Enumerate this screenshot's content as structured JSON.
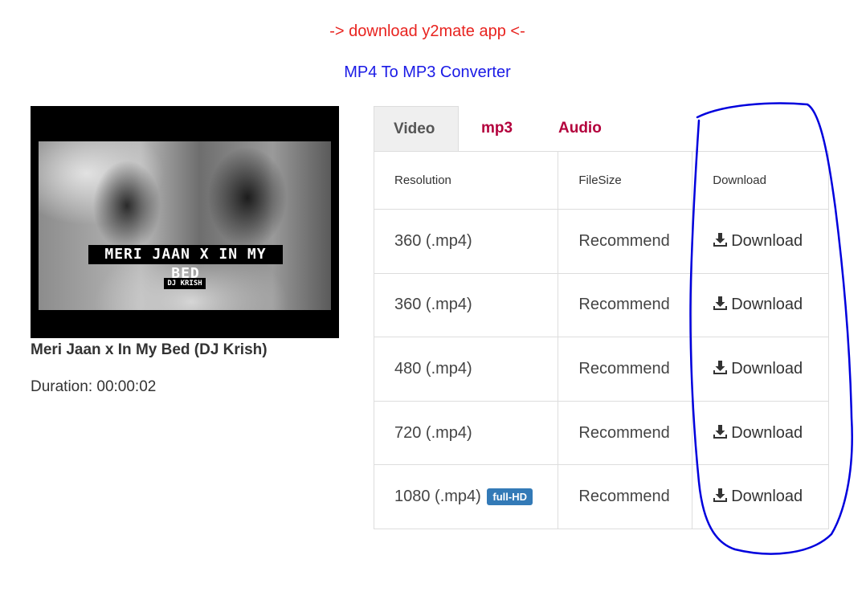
{
  "header": {
    "app_link": "-> download y2mate app <-",
    "converter_link": "MP4 To MP3 Converter"
  },
  "video": {
    "thumbnail_title": "MERI JAAN X IN MY BED",
    "thumbnail_sub": "DJ KRISH",
    "title": "Meri Jaan x In My Bed (DJ Krish)",
    "duration": "Duration: 00:00:02"
  },
  "tabs": [
    {
      "label": "Video",
      "active": true
    },
    {
      "label": "mp3",
      "active": false
    },
    {
      "label": "Audio",
      "active": false
    }
  ],
  "table": {
    "headers": [
      "Resolution",
      "FileSize",
      "Download"
    ],
    "rows": [
      {
        "resolution": "360 (.mp4)",
        "badge": "",
        "size": "Recommend",
        "action": "Download"
      },
      {
        "resolution": "360 (.mp4)",
        "badge": "",
        "size": "Recommend",
        "action": "Download"
      },
      {
        "resolution": "480 (.mp4)",
        "badge": "",
        "size": "Recommend",
        "action": "Download"
      },
      {
        "resolution": "720 (.mp4)",
        "badge": "",
        "size": "Recommend",
        "action": "Download"
      },
      {
        "resolution": "1080 (.mp4)",
        "badge": "full-HD",
        "size": "Recommend",
        "action": "Download"
      }
    ]
  },
  "colors": {
    "app_link": "#e8231f",
    "converter_link": "#1a1ae6",
    "tab_inactive": "#b3003c",
    "badge": "#337ab7",
    "annotation": "#0000dd"
  },
  "icons": {
    "download": "download-icon"
  }
}
